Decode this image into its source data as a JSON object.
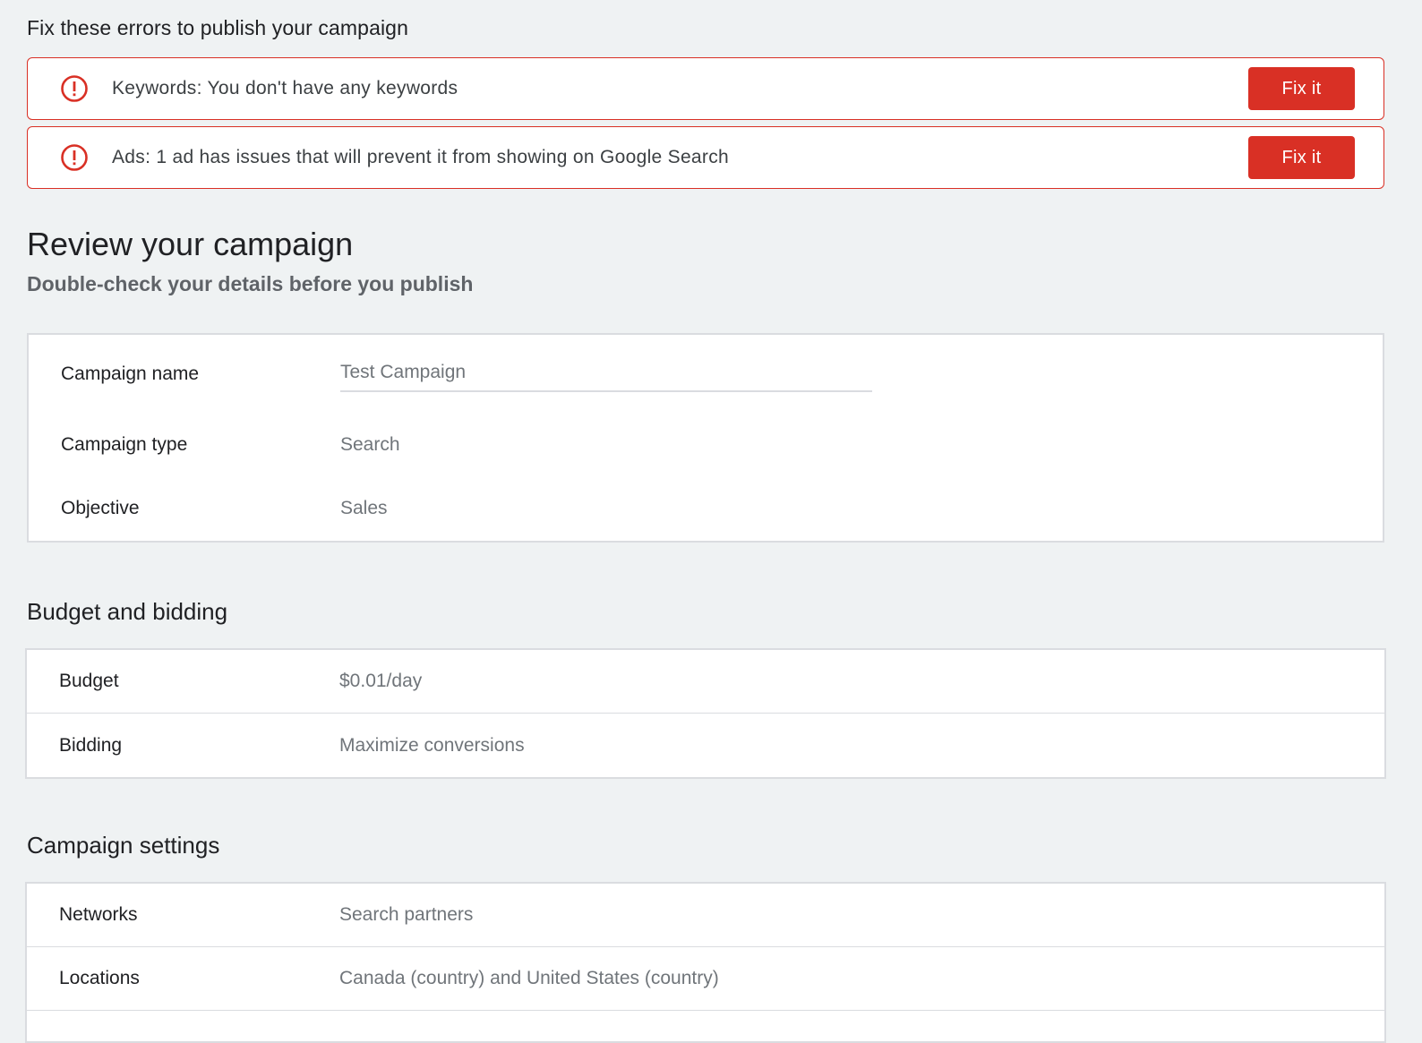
{
  "errors": {
    "title": "Fix these errors to publish your campaign",
    "items": [
      {
        "text": "Keywords: You don't have any keywords",
        "button": "Fix it"
      },
      {
        "text": "Ads: 1 ad has issues that will prevent it from showing on Google Search",
        "button": "Fix it"
      }
    ]
  },
  "review": {
    "title": "Review your campaign",
    "subtitle": "Double-check your details before you publish"
  },
  "details": {
    "campaign_name_label": "Campaign name",
    "campaign_name_value": "Test Campaign",
    "campaign_type_label": "Campaign type",
    "campaign_type_value": "Search",
    "objective_label": "Objective",
    "objective_value": "Sales"
  },
  "budget": {
    "title": "Budget and bidding",
    "rows": [
      {
        "label": "Budget",
        "value": "$0.01/day"
      },
      {
        "label": "Bidding",
        "value": "Maximize conversions"
      }
    ]
  },
  "settings": {
    "title": "Campaign settings",
    "rows": [
      {
        "label": "Networks",
        "value": "Search partners"
      },
      {
        "label": "Locations",
        "value": "Canada (country) and United States (country)"
      }
    ]
  },
  "colors": {
    "error": "#d93025",
    "background": "#eff2f3"
  }
}
